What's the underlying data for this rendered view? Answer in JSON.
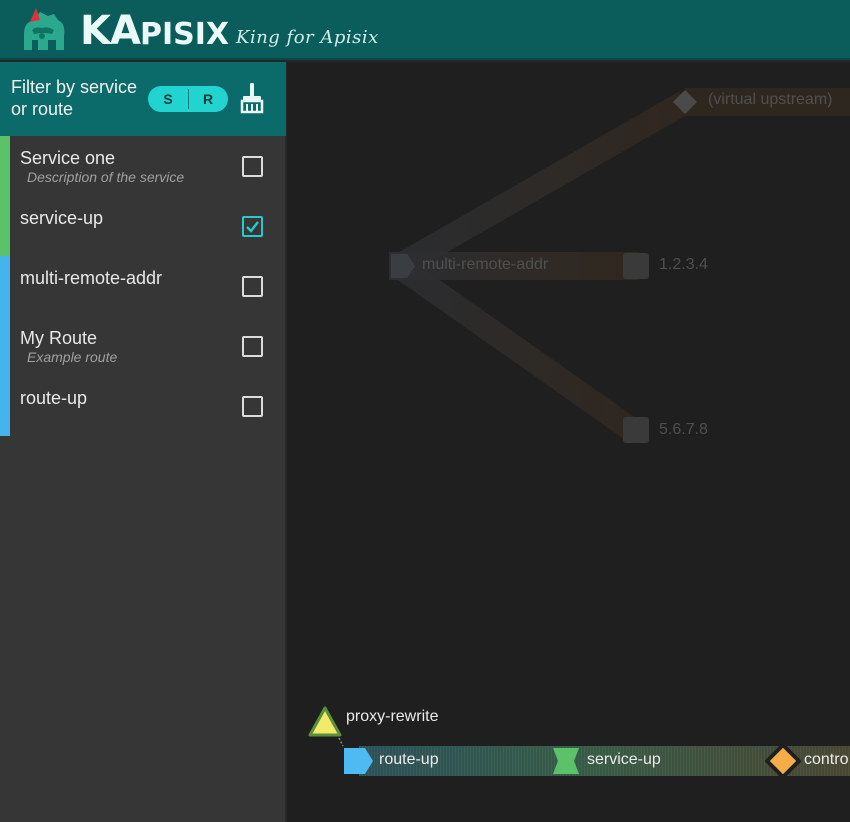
{
  "header": {
    "brand_ka": "KA",
    "brand_rest": "PISIX",
    "tagline": "King for Apisix"
  },
  "sidebar": {
    "filter_label": "Filter by service or route",
    "toggle": {
      "s": "S",
      "r": "R"
    },
    "items": [
      {
        "name": "Service one",
        "description": "Description of the service",
        "checked": false,
        "kind": "service"
      },
      {
        "name": "service-up",
        "description": "",
        "checked": true,
        "kind": "service"
      },
      {
        "name": "multi-remote-addr",
        "description": "",
        "checked": false,
        "kind": "route"
      },
      {
        "name": "My Route",
        "description": "Example route",
        "checked": false,
        "kind": "route"
      },
      {
        "name": "route-up",
        "description": "",
        "checked": false,
        "kind": "route"
      }
    ]
  },
  "graph": {
    "faded": {
      "virtual_upstream": "(virtual upstream)",
      "route": "multi-remote-addr",
      "node1": "1.2.3.4",
      "node2": "5.6.7.8"
    },
    "active": {
      "plugin": "proxy-rewrite",
      "route": "route-up",
      "service": "service-up",
      "upstream": "contro"
    }
  },
  "colors": {
    "header": "#0b5d5c",
    "filter": "#0b6b6a",
    "service_bar": "#5cc26a",
    "route_bar": "#45b3ec",
    "toggle": "#22d4d0",
    "checkbox_checked": "#27c9cc"
  }
}
